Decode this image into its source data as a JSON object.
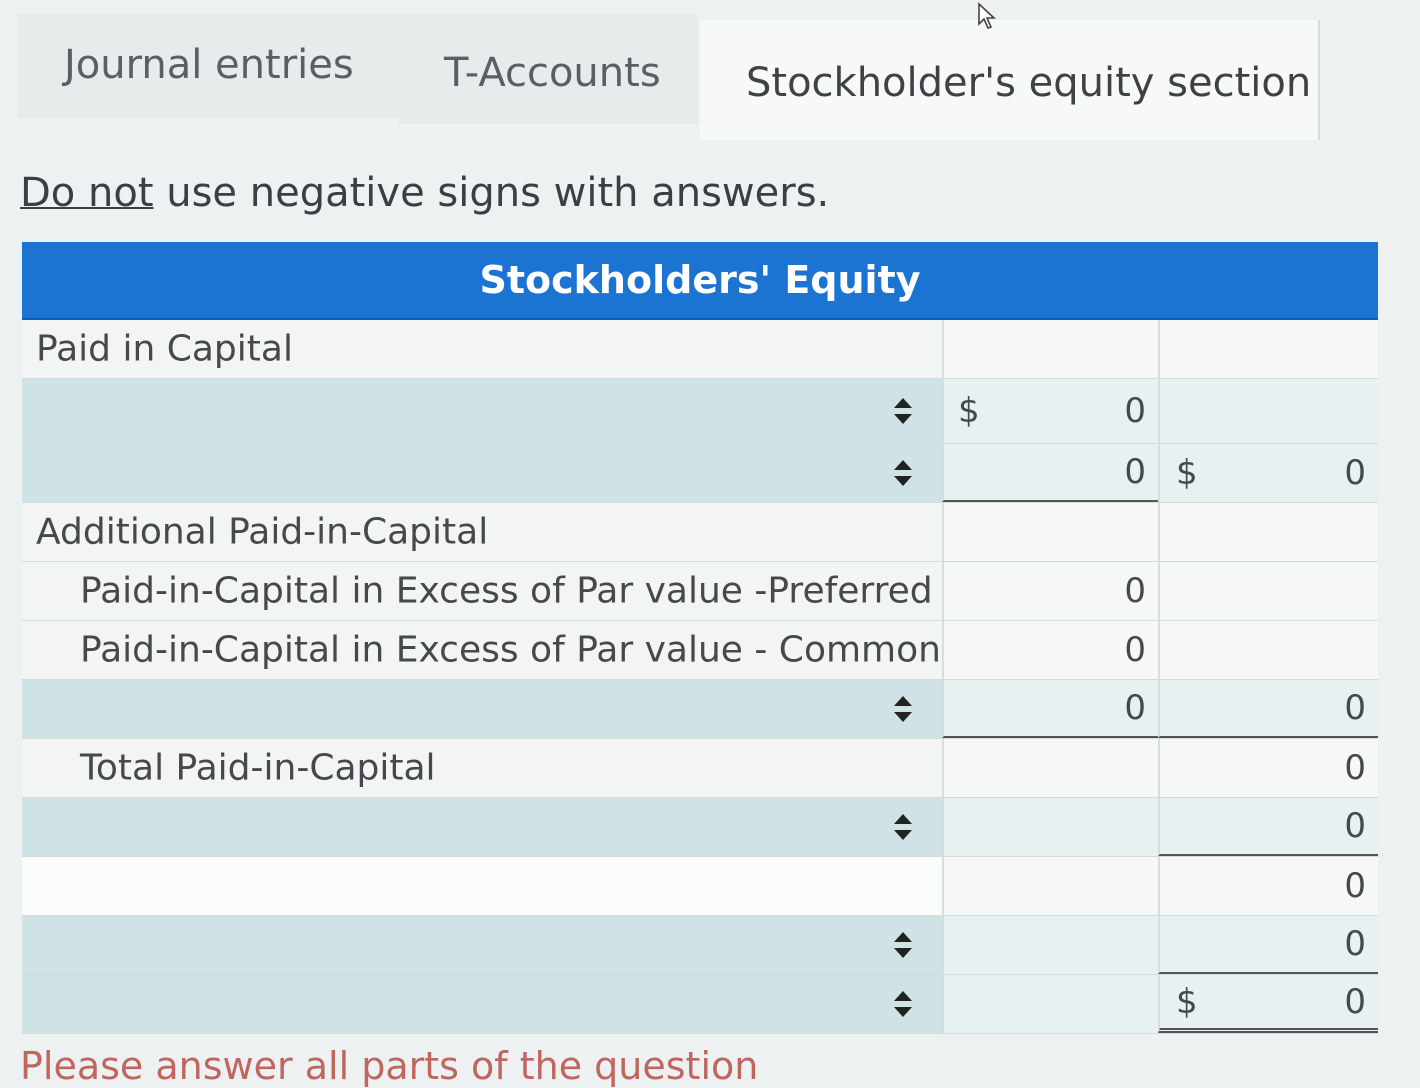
{
  "tabs": [
    "Journal entries",
    "T-Accounts",
    "Stockholder's equity section"
  ],
  "instruction": {
    "emphasis": "Do not",
    "rest": " use negative signs with answers."
  },
  "table": {
    "title": "Stockholders' Equity",
    "rows": [
      {
        "label": "Paid in Capital",
        "c1": "",
        "c2": ""
      },
      {
        "label": "",
        "select": true,
        "c1_prefix": "$",
        "c1": "0",
        "c2": ""
      },
      {
        "label": "",
        "select": true,
        "c1": "0",
        "c2_prefix": "$",
        "c2": "0"
      },
      {
        "label": "Additional Paid-in-Capital",
        "c1": "",
        "c2": ""
      },
      {
        "label": "Paid-in-Capital in Excess of Par value -Preferred Stock",
        "c1": "0",
        "c2": ""
      },
      {
        "label": "Paid-in-Capital in Excess of Par value - Common Stock",
        "c1": "0",
        "c2": ""
      },
      {
        "label": "",
        "select": true,
        "c1": "0",
        "c2": "0"
      },
      {
        "label": "Total Paid-in-Capital",
        "c1": "",
        "c2": "0"
      },
      {
        "label": "",
        "select": true,
        "c1": "",
        "c2": "0"
      },
      {
        "label": "",
        "c1": "",
        "c2": "0"
      },
      {
        "label": "",
        "select": true,
        "c1": "",
        "c2": "0"
      },
      {
        "label": "",
        "select": true,
        "c1": "",
        "c2_prefix": "$",
        "c2": "0"
      }
    ]
  },
  "footer": "Please answer all parts of the question",
  "colors": {
    "header_blue": "#1b74d1",
    "select_row": "#cfe2e5",
    "footer_text": "#c0665f"
  },
  "icons": {
    "spinner": "up-down-arrows-icon",
    "cursor": "mouse-pointer-icon"
  }
}
